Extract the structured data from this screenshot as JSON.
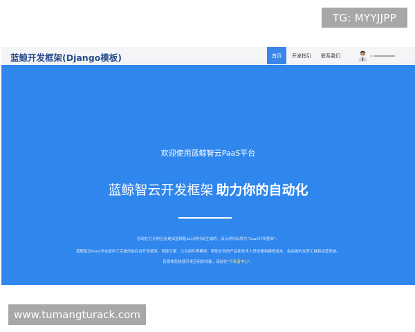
{
  "watermarks": {
    "top": "TG: MYYJJPP",
    "bottom": "www.tumangturack.com"
  },
  "navbar": {
    "brand": "蓝鲸开发框架(Django模板)",
    "items": [
      {
        "label": "首页",
        "active": true
      },
      {
        "label": "开发指引",
        "active": false
      },
      {
        "label": "联系我们",
        "active": false
      }
    ]
  },
  "hero": {
    "welcome": "欢迎使用蓝鲸智云PaaS平台",
    "headline_part1": "蓝鲸智云开发框架",
    "headline_part2": "助力你的自动化",
    "desc_line1": "您现在打开的应用是由蓝鲸智云示例代码生成的，该示例代码称为\"SaaS开发框架\"。",
    "desc_line2": "蓝鲸智云PaaS平台提供了完善的前后台开发框架、调度引擎、公共组件等模块，帮助业务的产品和技术人员快速构建低成本、免运维的支撑工具和运营系统。",
    "desc_line3_prefix": "若想体验快速开发应用的功能，请前往\"",
    "desc_line3_link": "开发者中心",
    "desc_line3_suffix": "\"。"
  },
  "colors": {
    "hero_background": "#2f86ec",
    "nav_active": "#3a86e8",
    "brand_text": "#2a4d8c",
    "link_highlight": "#ffe36b"
  },
  "icons": {
    "avatar": "user-avatar-icon"
  }
}
